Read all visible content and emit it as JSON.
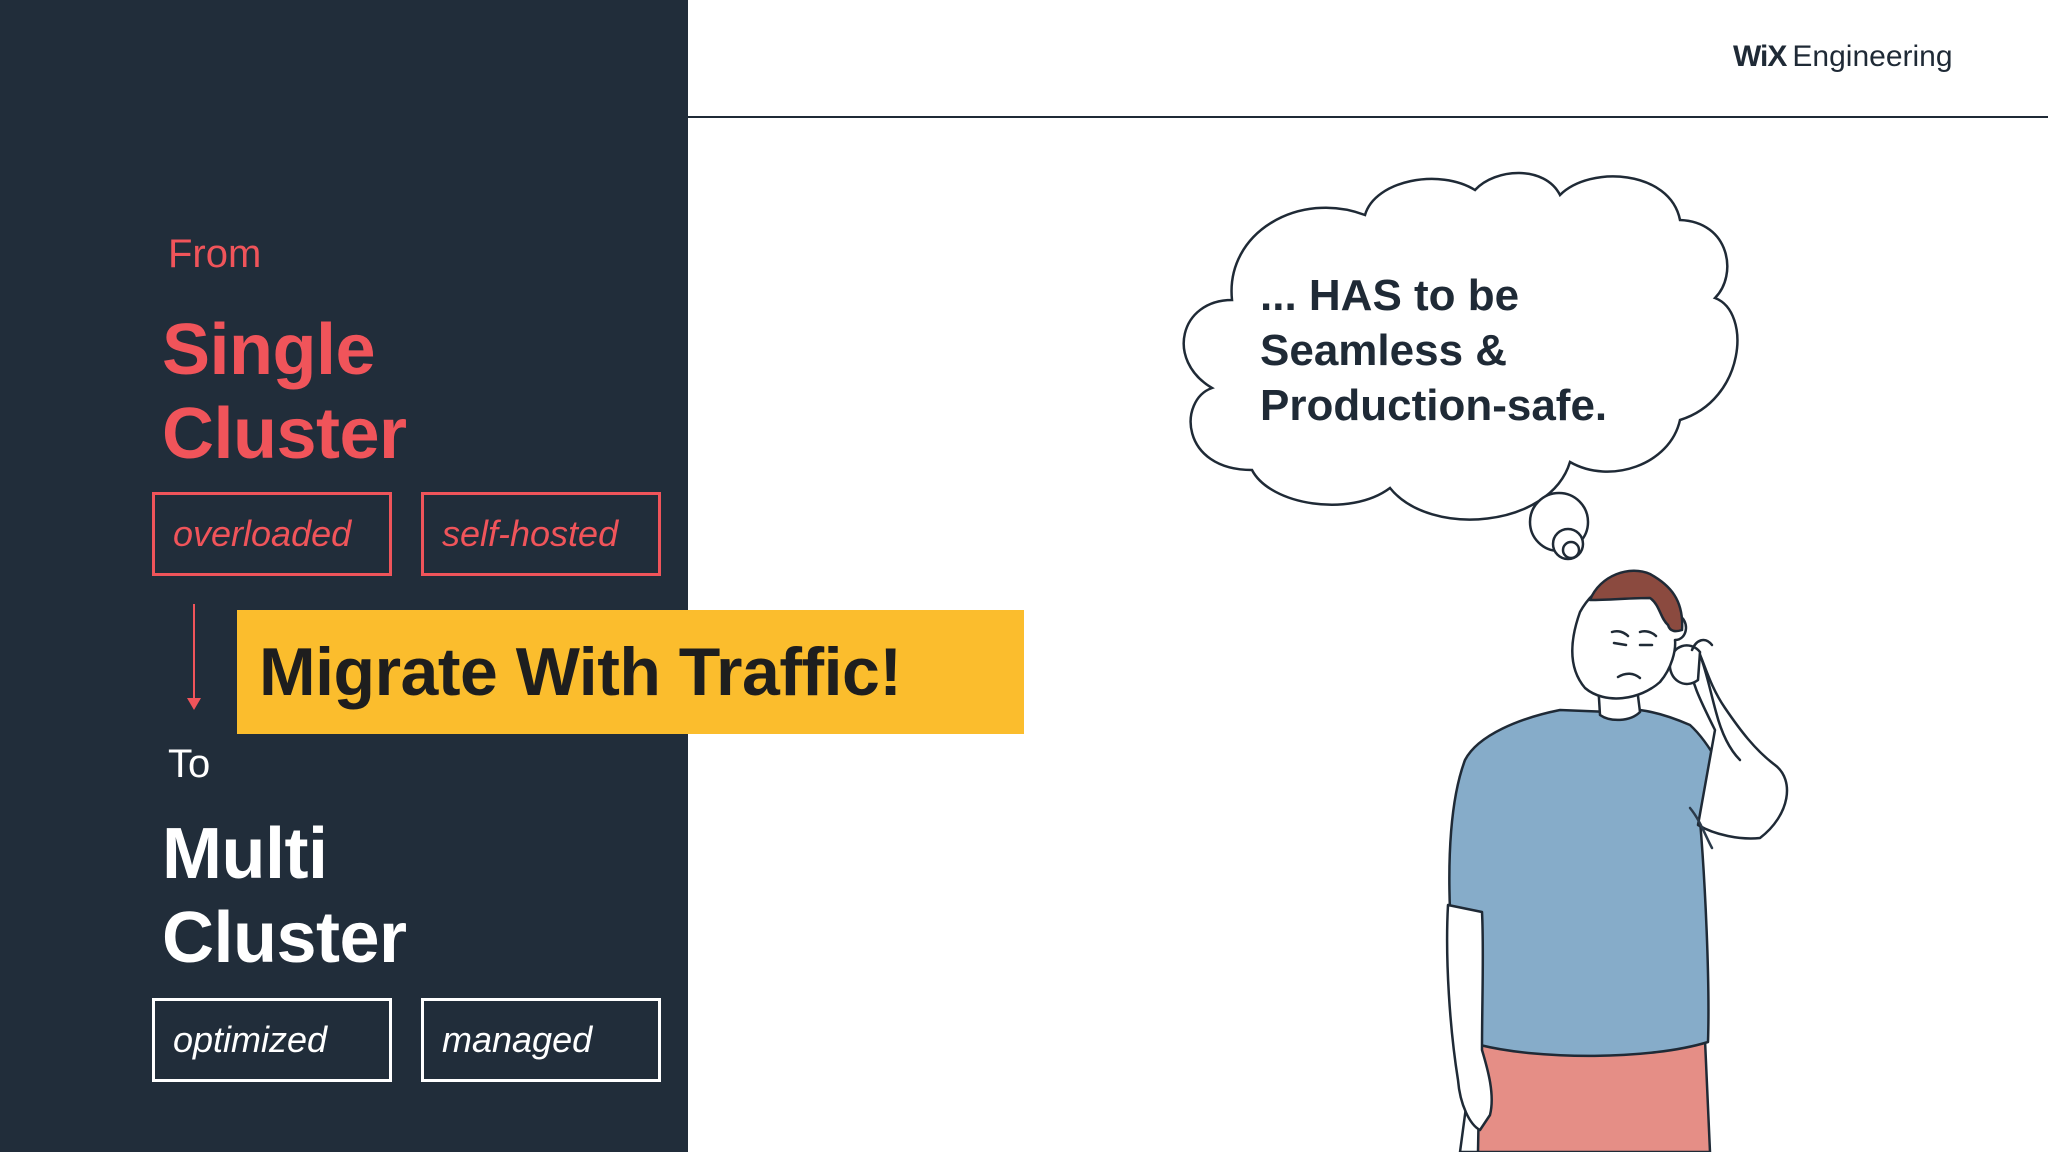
{
  "brand": {
    "logo": "WiX",
    "name": "Engineering"
  },
  "from": {
    "label": "From",
    "title_line1": "Single",
    "title_line2": "Cluster",
    "tags": [
      "overloaded",
      "self-hosted"
    ]
  },
  "to": {
    "label": "To",
    "title_line1": "Multi",
    "title_line2": "Cluster",
    "tags": [
      "optimized",
      "managed"
    ]
  },
  "banner": {
    "text": "Migrate With Traffic!"
  },
  "thought": {
    "line1": "... HAS to be",
    "line2": "Seamless &",
    "line3": "Production-safe."
  },
  "colors": {
    "left_bg": "#212d3a",
    "accent_red": "#f0545a",
    "banner_yellow": "#fbbd2d",
    "shirt_blue": "#86acc9",
    "pants_pink": "#e58e86",
    "hair_brown": "#8b4a3f",
    "skin": "#ffffff"
  },
  "icons": [
    "thinking-person-illustration",
    "thought-cloud-icon",
    "arrow-down-icon"
  ]
}
